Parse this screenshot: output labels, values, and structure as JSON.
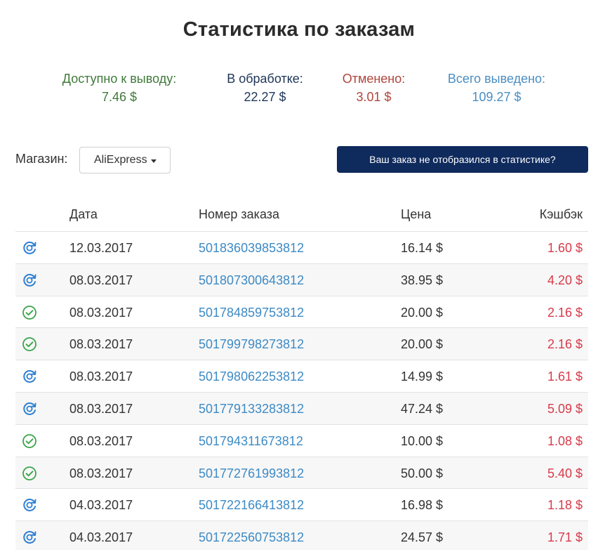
{
  "page": {
    "title": "Статистика по заказам"
  },
  "stats": {
    "available": {
      "label": "Доступно к выводу:",
      "value": "7.46 $"
    },
    "processing": {
      "label": "В обработке:",
      "value": "22.27 $"
    },
    "cancelled": {
      "label": "Отменено:",
      "value": "3.01 $"
    },
    "withdrawn": {
      "label": "Всего выведено:",
      "value": "109.27 $"
    }
  },
  "store": {
    "label": "Магазин:",
    "selected": "AliExpress"
  },
  "missing_order_button": "Ваш заказ не отобразился в статистике?",
  "table": {
    "headers": {
      "date": "Дата",
      "order": "Номер заказа",
      "price": "Цена",
      "cashback": "Кэшбэк"
    },
    "rows": [
      {
        "status": "pending",
        "date": "12.03.2017",
        "order": "501836039853812",
        "price": "16.14 $",
        "cashback": "1.60 $"
      },
      {
        "status": "pending",
        "date": "08.03.2017",
        "order": "501807300643812",
        "price": "38.95 $",
        "cashback": "4.20 $"
      },
      {
        "status": "completed",
        "date": "08.03.2017",
        "order": "501784859753812",
        "price": "20.00 $",
        "cashback": "2.16 $"
      },
      {
        "status": "completed",
        "date": "08.03.2017",
        "order": "501799798273812",
        "price": "20.00 $",
        "cashback": "2.16 $"
      },
      {
        "status": "pending",
        "date": "08.03.2017",
        "order": "501798062253812",
        "price": "14.99 $",
        "cashback": "1.61 $"
      },
      {
        "status": "pending",
        "date": "08.03.2017",
        "order": "501779133283812",
        "price": "47.24 $",
        "cashback": "5.09 $"
      },
      {
        "status": "completed",
        "date": "08.03.2017",
        "order": "501794311673812",
        "price": "10.00 $",
        "cashback": "1.08 $"
      },
      {
        "status": "completed",
        "date": "08.03.2017",
        "order": "501772761993812",
        "price": "50.00 $",
        "cashback": "5.40 $"
      },
      {
        "status": "pending",
        "date": "04.03.2017",
        "order": "501722166413812",
        "price": "16.98 $",
        "cashback": "1.18 $"
      },
      {
        "status": "pending",
        "date": "04.03.2017",
        "order": "501722560753812",
        "price": "24.57 $",
        "cashback": "1.71 $"
      }
    ]
  },
  "colors": {
    "pending_icon": "#2f7fd0",
    "completed_icon": "#3aa54a",
    "button_bg": "#0f2a5c",
    "cashback": "#d83a4a",
    "order_link": "#3d8ac4"
  }
}
